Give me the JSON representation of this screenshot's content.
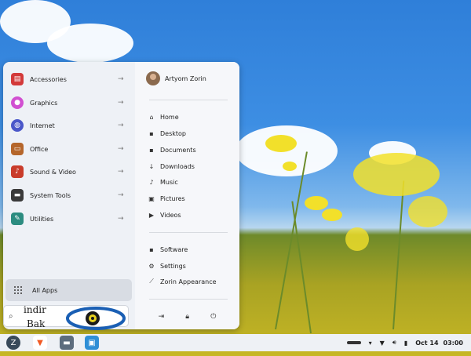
{
  "menu": {
    "categories": [
      {
        "label": "Accessories",
        "icon": "toolbox-icon",
        "color": "#d33a3a"
      },
      {
        "label": "Graphics",
        "icon": "palette-icon",
        "color": "#d14fd1"
      },
      {
        "label": "Internet",
        "icon": "globe-icon",
        "color": "#4a57c9"
      },
      {
        "label": "Office",
        "icon": "briefcase-icon",
        "color": "#b5662b"
      },
      {
        "label": "Sound & Video",
        "icon": "media-icon",
        "color": "#c93c2b"
      },
      {
        "label": "System Tools",
        "icon": "monitor-icon",
        "color": "#3a3a3a"
      },
      {
        "label": "Utilities",
        "icon": "utilities-icon",
        "color": "#2c8c80"
      }
    ],
    "all_apps_label": "All Apps",
    "user_name": "Artyom Zorin",
    "places": [
      {
        "label": "Home",
        "icon": "home-icon"
      },
      {
        "label": "Desktop",
        "icon": "desktop-icon"
      },
      {
        "label": "Documents",
        "icon": "documents-icon"
      },
      {
        "label": "Downloads",
        "icon": "download-icon"
      },
      {
        "label": "Music",
        "icon": "music-icon"
      },
      {
        "label": "Pictures",
        "icon": "pictures-icon"
      },
      {
        "label": "Videos",
        "icon": "videos-icon"
      }
    ],
    "system": [
      {
        "label": "Software",
        "icon": "software-icon"
      },
      {
        "label": "Settings",
        "icon": "settings-icon"
      },
      {
        "label": "Zorin Appearance",
        "icon": "appearance-icon"
      }
    ]
  },
  "taskbar": {
    "date": "Oct 14",
    "time": "03:00"
  },
  "watermark": {
    "line1": "indir",
    "line2": "Bak"
  }
}
